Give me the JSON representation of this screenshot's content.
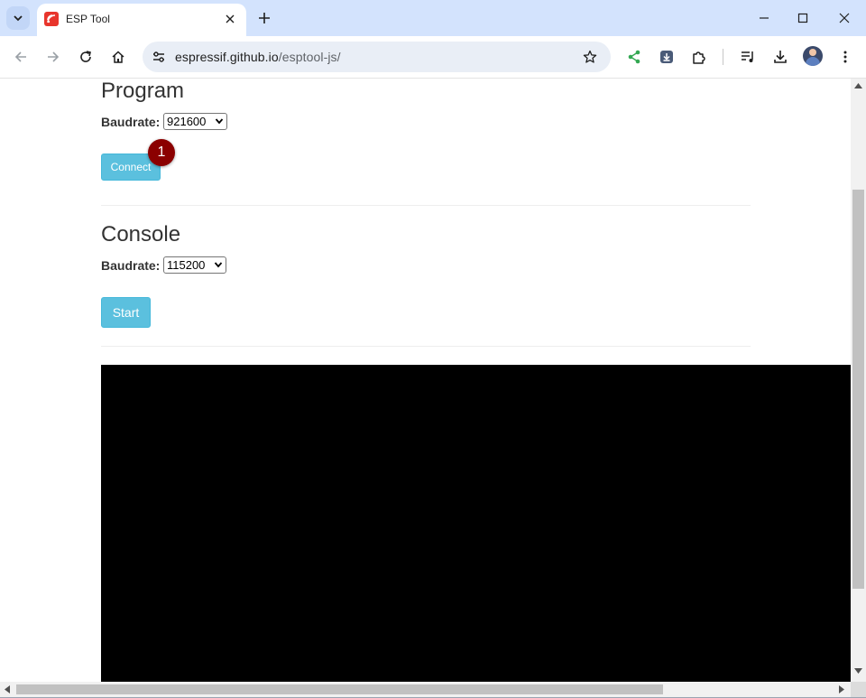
{
  "browser": {
    "tab_title": "ESP Tool",
    "url_host": "espressif.github.io",
    "url_path": "/esptool-js/"
  },
  "colors": {
    "tabstrip_bg": "#d3e3fd",
    "button_info": "#5bc0de",
    "badge": "#8b0000",
    "terminal_bg": "#000000",
    "share_icon": "#34a853"
  },
  "icons": {
    "tab_menu": "chevron-down-icon",
    "favicon": "espressif-logo-icon",
    "tab_close": "close-icon",
    "new_tab": "plus-icon",
    "minimize": "minimize-icon",
    "maximize": "maximize-icon",
    "close_window": "close-icon",
    "back": "arrow-left-icon",
    "forward": "arrow-right-icon",
    "reload": "reload-icon",
    "home": "home-icon",
    "site_info": "tune-icon",
    "bookmark": "star-icon",
    "share": "share-icon",
    "install": "install-icon",
    "extensions": "puzzle-icon",
    "media": "media-queue-icon",
    "downloads": "download-icon",
    "menu": "kebab-menu-icon"
  },
  "program": {
    "title": "Program",
    "baudrate_label": "Baudrate:",
    "baudrate_value": "921600",
    "connect_label": "Connect"
  },
  "console": {
    "title": "Console",
    "baudrate_label": "Baudrate:",
    "baudrate_value": "115200",
    "start_label": "Start"
  },
  "annotation": {
    "step_number": "1"
  }
}
